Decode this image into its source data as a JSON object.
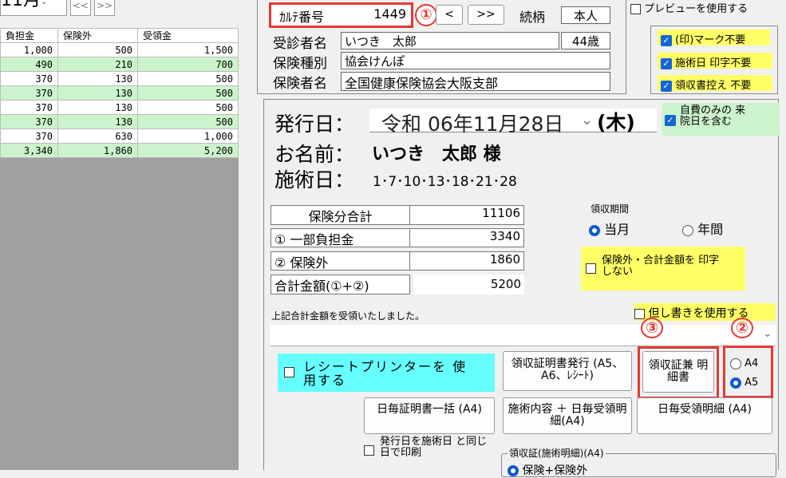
{
  "left": {
    "month": "11月",
    "nav_prev": "<<",
    "nav_next": ">>",
    "headers": [
      "負担金",
      "保険外",
      "受領金"
    ],
    "rows": [
      {
        "a": "1,000",
        "b": "500",
        "c": "1,500",
        "hl": false
      },
      {
        "a": "490",
        "b": "210",
        "c": "700",
        "hl": true
      },
      {
        "a": "370",
        "b": "130",
        "c": "500",
        "hl": false
      },
      {
        "a": "370",
        "b": "130",
        "c": "500",
        "hl": true
      },
      {
        "a": "370",
        "b": "130",
        "c": "500",
        "hl": false
      },
      {
        "a": "370",
        "b": "130",
        "c": "500",
        "hl": true
      },
      {
        "a": "370",
        "b": "630",
        "c": "1,000",
        "hl": false
      },
      {
        "a": "3,340",
        "b": "1,860",
        "c": "5,200",
        "hl": true
      }
    ]
  },
  "patient": {
    "karte_label": "ｶﾙﾃ番号",
    "karte_value": "1449",
    "marker1": "①",
    "next_btn": ">>",
    "relation_label": "続柄",
    "relation_value": "本人",
    "name_label": "受診者名",
    "name_value": "いつき　太郎",
    "age_value": "44歳",
    "insurance_type_label": "保険種別",
    "insurance_type_value": "協会けんぽ",
    "insurer_label": "保険者名",
    "insurer_value": "全国健康保険協会大阪支部"
  },
  "options": {
    "preview": "プレビューを使用する",
    "no_mark": "(印)マーク不要",
    "no_treat_date": "施術日 印字不要",
    "no_receipt_copy": "領収書控え 不要"
  },
  "receipt": {
    "issue_label": "発行日：",
    "issue_date": "令和 06年11月28日",
    "weekday": "(木)",
    "self_pay_label": "自費のみの 来院日を含む",
    "name_label": "お名前：",
    "name_value": "いつき　太郎 様",
    "treat_label": "施術日：",
    "treat_dates": "1･7･10･13･18･21･28",
    "sum_rows": [
      {
        "label": "保険分合計",
        "value": "11106"
      },
      {
        "label": "① 一部負担金",
        "value": "3340"
      },
      {
        "label": "② 保険外",
        "value": "1860"
      },
      {
        "label": "合計金額(①+②)",
        "value": "5200"
      }
    ],
    "period_title": "領収期間",
    "period_month": "当月",
    "period_year": "年間",
    "no_print_extra": "保険外・合計金額を 印字しない",
    "received_text": "上記合計金額を受領いたしました。",
    "use_proviso": "但し書きを使用する",
    "marker2": "②",
    "marker3": "③",
    "receipt_printer": "レシートプリンターを 使用する",
    "btn_issue": "領収証明書発行 (A5、A6、ﾚｼｰﾄ)",
    "btn_detail": "領収証兼 明細書",
    "size_a4": "A4",
    "size_a5": "A5",
    "btn_daily_batch": "日毎証明書一括 (A4)",
    "btn_content": "施術内容 ＋ 日毎受領明細(A4)",
    "btn_daily_detail": "日毎受領明細 (A4)",
    "same_day_print": "発行日を施術日 と同じ日で印刷",
    "lower_group": "領収証(施術明細)(A4)",
    "lower_opt": "保険+保険外"
  }
}
